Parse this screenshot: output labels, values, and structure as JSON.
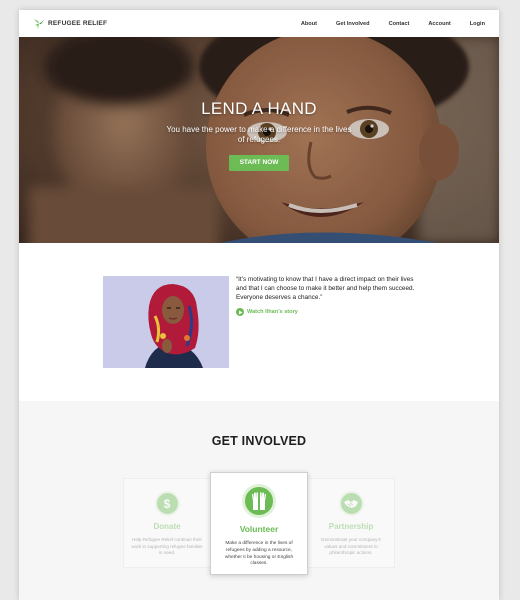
{
  "nav": {
    "brand": "REFUGEE RELIEF",
    "links": [
      "About",
      "Get Involved",
      "Contact",
      "Account",
      "Login"
    ]
  },
  "hero": {
    "title": "LEND A HAND",
    "subtitle": "You have the power to make a difference in the lives of refugees.",
    "cta": "START NOW"
  },
  "testimonial": {
    "quote": "“It’s motivating to know that I have a direct impact on their lives and that I can choose to make it better and help them succeed. Everyone deserves a chance.”",
    "link": "Watch Ilhan’s story"
  },
  "involved": {
    "title": "GET INVOLVED",
    "cards": [
      {
        "title": "Donate",
        "desc": "Help Refugee Relief continue their work in supporting refugee families in need.",
        "icon": "dollar-icon"
      },
      {
        "title": "Volunteer",
        "desc": "Make a difference in the lives of refugees by adding a resource, whether it be housing or English classes.",
        "icon": "raised-hands-icon"
      },
      {
        "title": "Partnership",
        "desc": "Demonstrate your company’s values and commitment to philanthropic actions.",
        "icon": "handshake-icon"
      }
    ]
  },
  "colors": {
    "accent": "#6cbb55",
    "text": "#222222",
    "section_bg": "#f6f6f6"
  }
}
